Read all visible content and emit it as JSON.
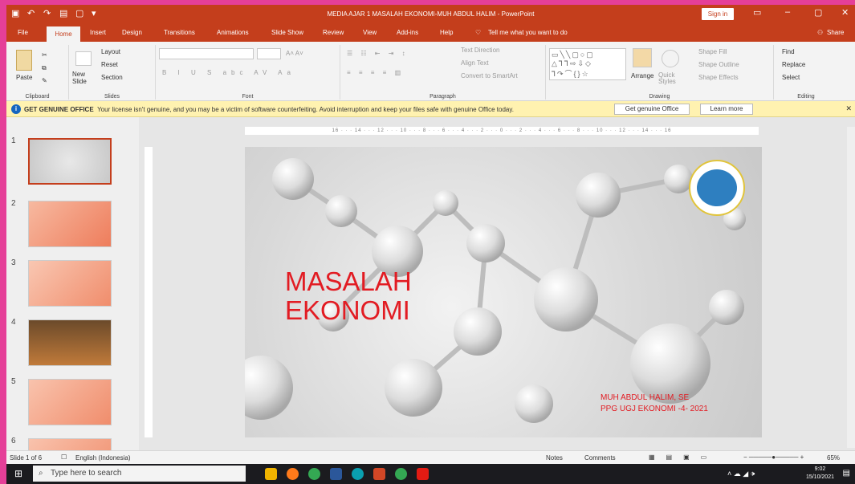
{
  "window": {
    "title": "MEDIA AJAR 1 MASALAH EKONOMI-MUH ABDUL HALIM - PowerPoint",
    "signin": "Sign in"
  },
  "tabs": [
    {
      "label": "File"
    },
    {
      "label": "Home"
    },
    {
      "label": "Insert"
    },
    {
      "label": "Design"
    },
    {
      "label": "Transitions"
    },
    {
      "label": "Animations"
    },
    {
      "label": "Slide Show"
    },
    {
      "label": "Review"
    },
    {
      "label": "View"
    },
    {
      "label": "Add-ins"
    },
    {
      "label": "Help"
    }
  ],
  "tell_me": "Tell me what you want to do",
  "share": "Share",
  "ribbon": {
    "clipboard": {
      "paste": "Paste",
      "label": "Clipboard"
    },
    "slides": {
      "new_slide": "New Slide",
      "layout": "Layout",
      "reset": "Reset",
      "section": "Section",
      "label": "Slides"
    },
    "font": {
      "label": "Font"
    },
    "paragraph": {
      "text_direction": "Text Direction",
      "align_text": "Align Text",
      "smartart": "Convert to SmartArt",
      "label": "Paragraph"
    },
    "drawing": {
      "arrange": "Arrange",
      "quick_styles": "Quick Styles",
      "shape_fill": "Shape Fill",
      "shape_outline": "Shape Outline",
      "shape_effects": "Shape Effects",
      "label": "Drawing"
    },
    "editing": {
      "find": "Find",
      "replace": "Replace",
      "select": "Select",
      "label": "Editing"
    }
  },
  "banner": {
    "title": "GET GENUINE OFFICE",
    "message": "Your license isn't genuine, and you may be a victim of software counterfeiting. Avoid interruption and keep your files safe with genuine Office today.",
    "btn_genuine": "Get genuine Office",
    "btn_learn": "Learn more"
  },
  "ruler": {
    "text": "16 · · · 14 · · · 12 · · · 10 · · · 8 · · · 6 · · · 4 · · · 2 · · · 0 · · · 2 · · · 4 · · · 6 · · · 8 · · · 10 · · · 12 · · · 14 · · · 16"
  },
  "thumbnails": [
    {
      "num": "1"
    },
    {
      "num": "2"
    },
    {
      "num": "3"
    },
    {
      "num": "4"
    },
    {
      "num": "5"
    },
    {
      "num": "6"
    }
  ],
  "slide": {
    "title": "MASALAH EKONOMI",
    "author": "MUH ABDUL HALIM, SE\nPPG UGJ EKONOMI -4- 2021"
  },
  "status": {
    "slide_info": "Slide 1 of 6",
    "language": "English (Indonesia)",
    "notes": "Notes",
    "comments": "Comments",
    "zoom": "65%"
  },
  "taskbar": {
    "search_placeholder": "Type here to search",
    "time": "9:02",
    "date": "15/10/2021"
  },
  "colors": {
    "accent": "#c43e1c",
    "frame": "#e53f98",
    "title_red": "#e21c23"
  }
}
